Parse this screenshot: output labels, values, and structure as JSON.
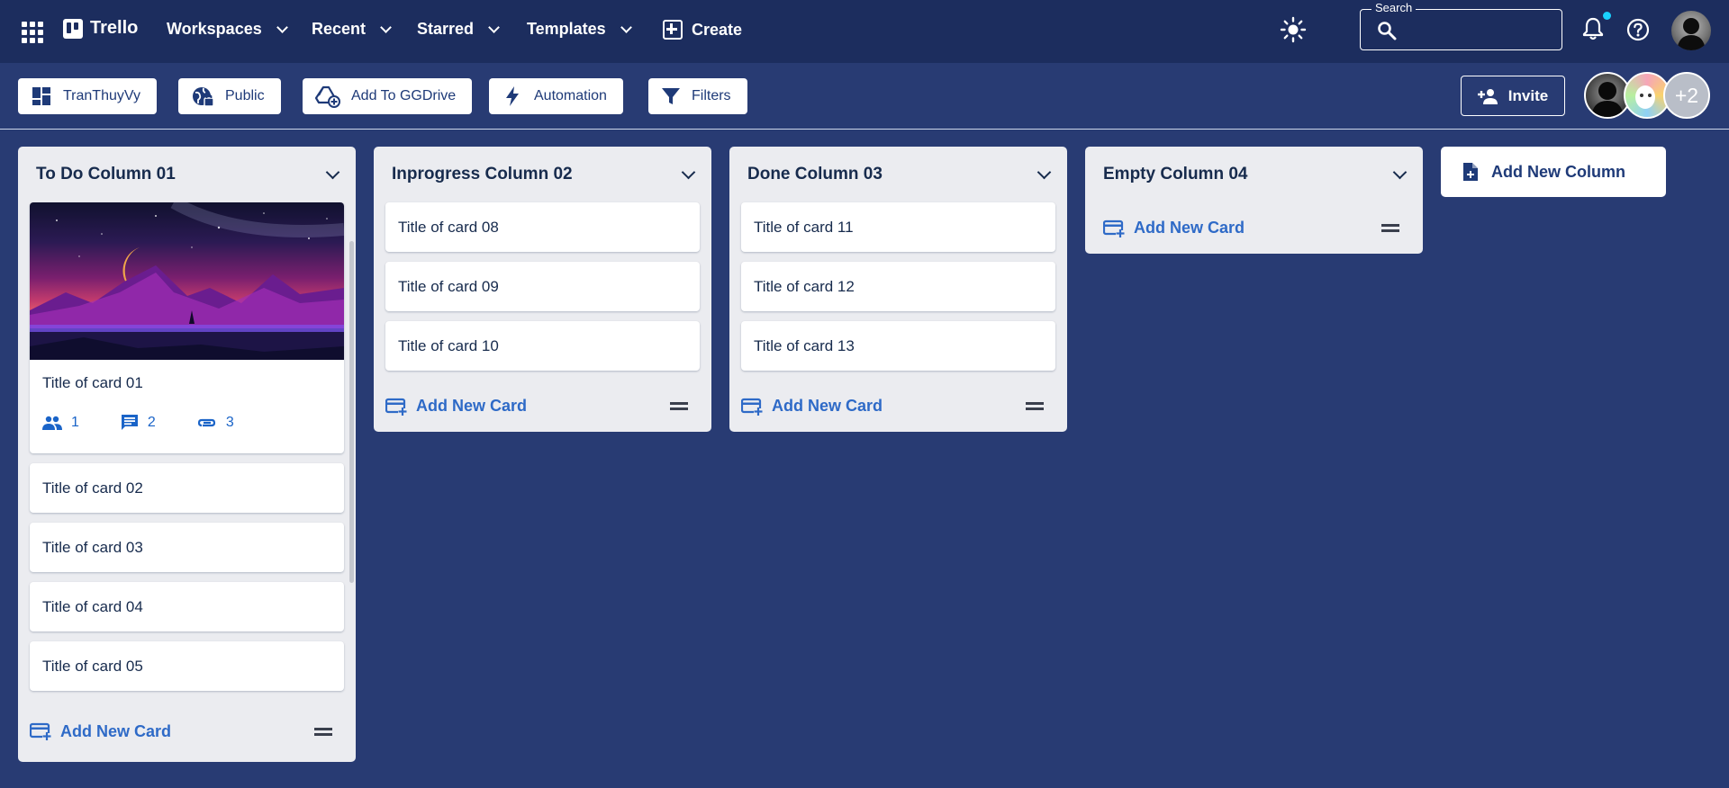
{
  "appbar": {
    "brand": "Trello",
    "menus": [
      {
        "label": "Workspaces"
      },
      {
        "label": "Recent"
      },
      {
        "label": "Starred"
      },
      {
        "label": "Templates"
      }
    ],
    "create_label": "Create",
    "search_legend": "Search",
    "search_value": ""
  },
  "boardbar": {
    "board_name": "TranThuyVy",
    "visibility": "Public",
    "drive": "Add To GGDrive",
    "automation": "Automation",
    "filters": "Filters",
    "invite": "Invite",
    "extra_members": "+2"
  },
  "columns": [
    {
      "title": "To Do Column 01",
      "cards": [
        {
          "title": "Title of card 01",
          "members": "1",
          "comments": "2",
          "attachments": "3"
        },
        {
          "title": "Title of card 02"
        },
        {
          "title": "Title of card 03"
        },
        {
          "title": "Title of card 04"
        },
        {
          "title": "Title of card 05"
        }
      ],
      "add_label": "Add New Card"
    },
    {
      "title": "Inprogress Column 02",
      "cards": [
        {
          "title": "Title of card 08"
        },
        {
          "title": "Title of card 09"
        },
        {
          "title": "Title of card 10"
        }
      ],
      "add_label": "Add New Card"
    },
    {
      "title": "Done Column 03",
      "cards": [
        {
          "title": "Title of card 11"
        },
        {
          "title": "Title of card 12"
        },
        {
          "title": "Title of card 13"
        }
      ],
      "add_label": "Add New Card"
    },
    {
      "title": "Empty Column 04",
      "cards": [],
      "add_label": "Add New Card"
    }
  ],
  "add_column_label": "Add New Column",
  "colors": {
    "appbar": "#1c2d5e",
    "board_bg": "#283b73",
    "column_bg": "#ebecf0",
    "accent": "#2e6ac7",
    "notification_dot": "#19d2ff"
  }
}
